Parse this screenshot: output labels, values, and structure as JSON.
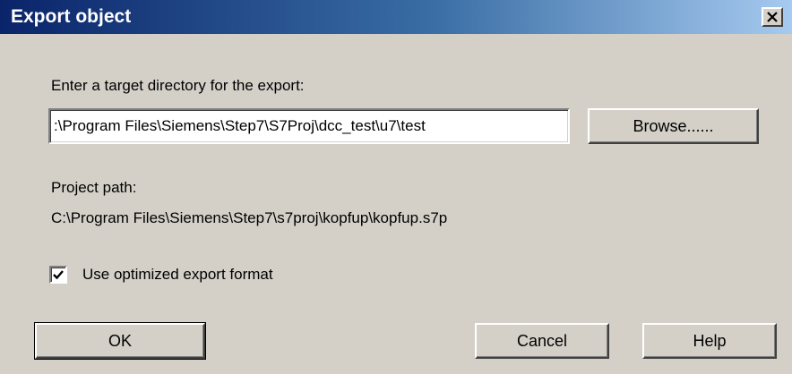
{
  "window": {
    "title": "Export object",
    "close_glyph": "✕"
  },
  "form": {
    "target_label": "Enter a target directory for the export:",
    "target_value": ":\\Program Files\\Siemens\\Step7\\S7Proj\\dcc_test\\u7\\test",
    "browse_label": "Browse......",
    "project_path_label": "Project path:",
    "project_path_value": "C:\\Program Files\\Siemens\\Step7\\s7proj\\kopfup\\kopfup.s7p",
    "optimized_label": "Use optimized export format",
    "optimized_checked": true
  },
  "buttons": {
    "ok": "OK",
    "cancel": "Cancel",
    "help": "Help"
  },
  "colors": {
    "titlebar_start": "#0a246a",
    "titlebar_end": "#a6caf0",
    "dialog_bg": "#d4d0c8"
  },
  "icons": {
    "close": "close-icon",
    "checkmark": "checkmark-icon"
  }
}
